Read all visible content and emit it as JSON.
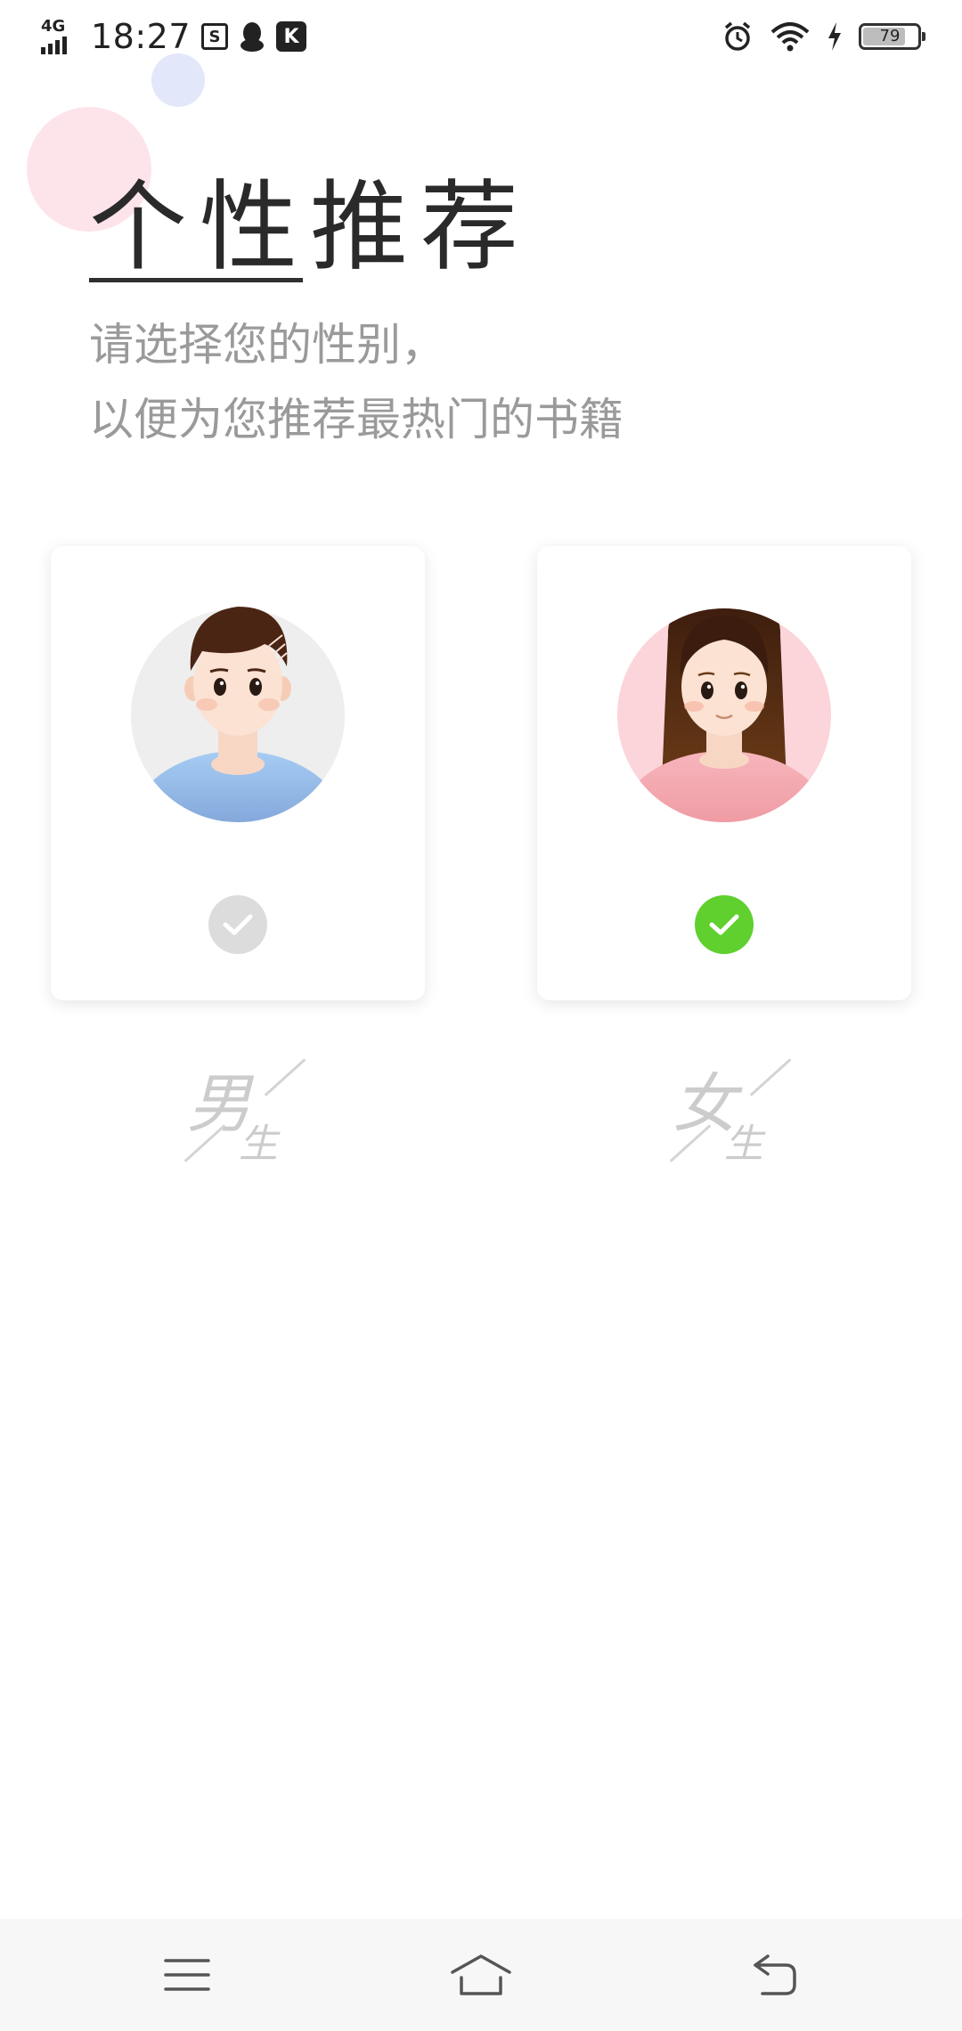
{
  "status_bar": {
    "network": "4G",
    "time": "18:27",
    "battery": "79",
    "icons": [
      "signal-icon",
      "s-box-icon",
      "qq-icon",
      "k-app-icon",
      "alarm-icon",
      "wifi-icon",
      "charging-icon",
      "battery-icon"
    ]
  },
  "header": {
    "title": "个性推荐",
    "subtitle_line1": "请选择您的性别，",
    "subtitle_line2": "以便为您推荐最热门的书籍"
  },
  "options": {
    "male": {
      "label_big": "男",
      "label_small": "生",
      "selected": false
    },
    "female": {
      "label_big": "女",
      "label_small": "生",
      "selected": true
    }
  },
  "colors": {
    "accent_check": "#5fd02e",
    "unchecked": "#dcdcdc",
    "female_bg": "#fbd5da",
    "male_bg": "#eeeeee",
    "male_shirt": "#8fb4e8",
    "female_shirt": "#f19aa3"
  },
  "nav_bar": {
    "icons": [
      "menu-icon",
      "home-icon",
      "back-icon"
    ]
  }
}
